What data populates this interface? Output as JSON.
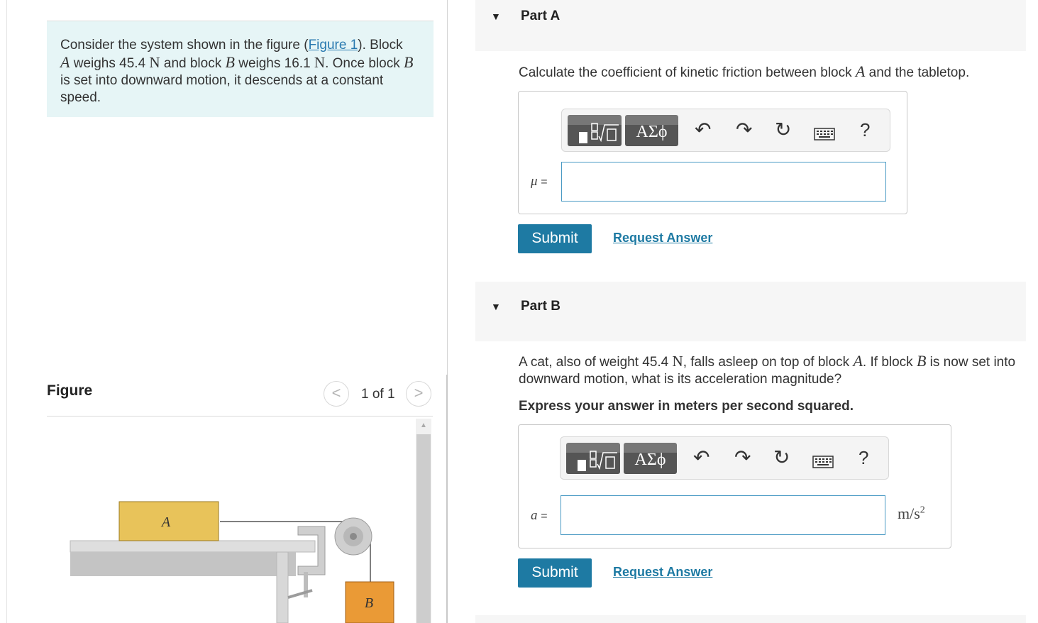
{
  "intro": {
    "t1": "Consider the system shown in the figure (",
    "link": "Figure 1",
    "t2": "). Block ",
    "varA": "A",
    "t3": " weighs 45.4 ",
    "unitN1": "N",
    "t4": " and block ",
    "varB": "B",
    "t5": " weighs 16.1 ",
    "unitN2": "N",
    "t6": ". Once block ",
    "varB2": "B",
    "t7": " is set into downward motion, it descends at a constant speed."
  },
  "figure": {
    "label": "Figure",
    "counter": "1 of 1",
    "prev": "<",
    "next": ">",
    "block_a_label": "A",
    "block_b_label": "B"
  },
  "partA": {
    "caret": "▼",
    "title": "Part A",
    "q1": "Calculate the coefficient of kinetic friction between block ",
    "qvar": "A",
    "q2": " and the tabletop.",
    "greek": "ΑΣϕ",
    "help": "?",
    "var": "μ",
    "eq": "=",
    "input_value": "",
    "submit": "Submit",
    "request": "Request Answer"
  },
  "partB": {
    "caret": "▼",
    "title": "Part B",
    "q1": "A cat, also of weight 45.4 ",
    "unitN": "N",
    "q2": ", falls asleep on top of block ",
    "qvarA": "A",
    "q3": ". If block ",
    "qvarB": "B",
    "q4": " is now set into downward motion, what is its acceleration magnitude?",
    "instruction": "Express your answer in meters per second squared.",
    "greek": "ΑΣϕ",
    "help": "?",
    "var": "a",
    "eq": "=",
    "input_value": "",
    "units": "m/s",
    "units_exp": "2",
    "submit": "Submit",
    "request": "Request Answer"
  },
  "colors": {
    "accent": "#1e7aa3",
    "intro_bg": "#e6f5f6",
    "block_a": "#e8c35a",
    "block_b": "#ea9a36"
  }
}
